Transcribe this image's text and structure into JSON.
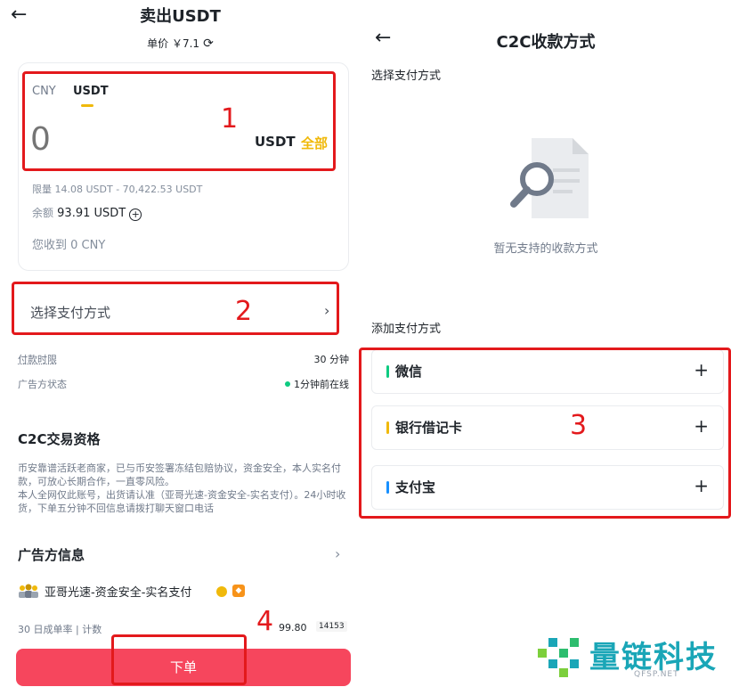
{
  "sell": {
    "title": "卖出USDT",
    "price": "单价 ￥7.1",
    "tabs": [
      "CNY",
      "USDT"
    ],
    "amount_value": "0",
    "unit": "USDT",
    "all_label": "全部",
    "limit": "限量 14.08 USDT - 70,422.53 USDT",
    "balance_label": "余额",
    "balance_value": "93.91 USDT",
    "receive": "您收到 0 CNY",
    "pay_method_label": "选择支付方式",
    "pay_time_label": "付款时限",
    "pay_time_value": "30 分钟",
    "ad_status_label": "广告方状态",
    "ad_status_value": "1分钟前在线",
    "c2c_title": "C2C交易资格",
    "c2c_desc": "币安靠谱活跃老商家，已与币安签署冻结包赔协议，资金安全，本人实名付款，可放心长期合作，一直零风险。\n本人全网仅此账号，出货请认准（亚哥光速-资金安全-实名支付）。24小时收货，下单五分钟不回信息请拨打聊天窗口电话",
    "advertiser_title": "广告方信息",
    "merchant_name": "亚哥光速-资金安全-实名支付",
    "stats_label": "30 日成单率 | 计数",
    "stats_rate": "99.80",
    "stats_count": "14153",
    "order_button": "下单"
  },
  "methods": {
    "title": "C2C收款方式",
    "select_label": "选择支付方式",
    "empty_text": "暂无支持的收款方式",
    "add_label": "添加支付方式",
    "items": [
      {
        "name": "微信",
        "color": "#0ecb81"
      },
      {
        "name": "银行借记卡",
        "color": "#f0b90b"
      },
      {
        "name": "支付宝",
        "color": "#1890ff"
      }
    ]
  },
  "annotations": [
    "1",
    "2",
    "3",
    "4"
  ],
  "watermark": {
    "brand": "量链科技",
    "domain": "QFSP.NET"
  },
  "colors": {
    "accent": "#f0b90b",
    "sell_button": "#f6465d",
    "annotation": "#e3191c",
    "online": "#0ecb81"
  }
}
